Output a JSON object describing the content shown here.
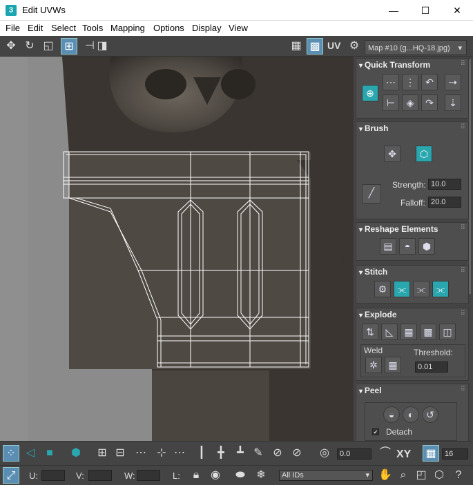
{
  "app": {
    "title": "Edit UVWs",
    "icon_text": "3"
  },
  "window_buttons": {
    "minimize": "—",
    "maximize": "☐",
    "close": "✕"
  },
  "menu": [
    "File",
    "Edit",
    "Select",
    "Tools",
    "Mapping",
    "Options",
    "Display",
    "View"
  ],
  "toolbar": {
    "uv_label": "UV",
    "map_select": "Map #10 (g...HQ-18.jpg)",
    "dropdown_arrow": "▾"
  },
  "panels": {
    "quick_transform": {
      "title": "Quick Transform"
    },
    "brush": {
      "title": "Brush",
      "strength_label": "Strength:",
      "strength_value": "10.0",
      "falloff_label": "Falloff:",
      "falloff_value": "20.0"
    },
    "reshape": {
      "title": "Reshape Elements"
    },
    "stitch": {
      "title": "Stitch"
    },
    "explode": {
      "title": "Explode",
      "weld_label": "Weld",
      "threshold_label": "Threshold:",
      "threshold_value": "0.01"
    },
    "peel": {
      "title": "Peel",
      "detach_label": "Detach",
      "detach_checked": true
    }
  },
  "bottom": {
    "offset_value": "0.0",
    "xy_label": "XY",
    "grid_value": "16",
    "u_label": "U:",
    "v_label": "V:",
    "w_label": "W:",
    "l_label": "L:",
    "ids_select": "All IDs"
  },
  "colors": {
    "accent": "#2aa6ae",
    "active": "#5a8fb3",
    "panel": "#4e4e4e",
    "background": "#444444"
  }
}
